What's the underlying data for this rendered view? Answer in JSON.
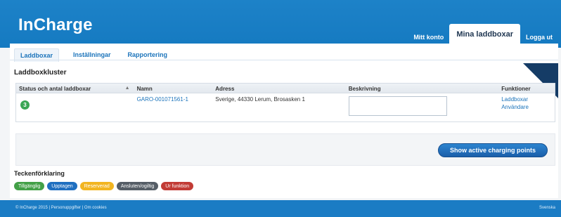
{
  "header": {
    "logo": "InCharge",
    "tabs": [
      {
        "label": "Mitt konto",
        "active": false
      },
      {
        "label": "Mina laddboxar",
        "active": true
      },
      {
        "label": "Logga ut",
        "active": false
      }
    ]
  },
  "subtabs": [
    "Laddboxar",
    "Inställningar",
    "Rapportering"
  ],
  "section_title": "Laddboxkluster",
  "table": {
    "headers": [
      "Status och antal laddboxar",
      "Namn",
      "Adress",
      "Beskrivning",
      "",
      "Funktioner"
    ],
    "rows": [
      {
        "status": "3",
        "name": "GARO-001071561-1",
        "address": "Sverige, 44330 Lerum, Brosasken 1",
        "description": "",
        "links": [
          "Laddboxar",
          "Användare"
        ]
      }
    ]
  },
  "show_button": "Show active charging points",
  "legend": {
    "title": "Teckenförklaring",
    "items": [
      {
        "label": "Tillgänglig",
        "color": "#43a047"
      },
      {
        "label": "Upptagen",
        "color": "#1f6fc0"
      },
      {
        "label": "Reserverad",
        "color": "#f2b521"
      },
      {
        "label": "Ansluten/ogiltig",
        "color": "#555d66"
      },
      {
        "label": "Ur funktion",
        "color": "#c23b35"
      }
    ]
  },
  "footer": {
    "left": "© InCharge 2015 | Personuppgifter | Om cookies",
    "right": "Svenska"
  },
  "colors": {
    "header": "#1d82c8",
    "accent": "#1c74bb",
    "footer": "#1b7cc4"
  }
}
